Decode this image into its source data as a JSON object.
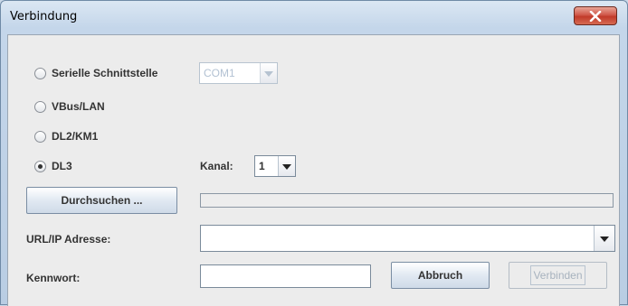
{
  "window": {
    "title": "Verbindung",
    "close_icon": "close-x-icon"
  },
  "connection": {
    "options": [
      {
        "label": "Serielle Schnittstelle",
        "checked": false
      },
      {
        "label": "VBus/LAN",
        "checked": false
      },
      {
        "label": "DL2/KM1",
        "checked": false
      },
      {
        "label": "DL3",
        "checked": true
      }
    ],
    "com_port": {
      "value": "COM1",
      "enabled": false
    },
    "channel": {
      "label": "Kanal:",
      "value": "1"
    }
  },
  "browse_button": {
    "label": "Durchsuchen ..."
  },
  "url": {
    "label": "URL/IP Adresse:",
    "value": ""
  },
  "password": {
    "label": "Kennwort:",
    "value": ""
  },
  "actions": {
    "cancel_label": "Abbruch",
    "connect_label": "Verbinden",
    "connect_enabled": false
  },
  "progress": {
    "value": 0
  }
}
